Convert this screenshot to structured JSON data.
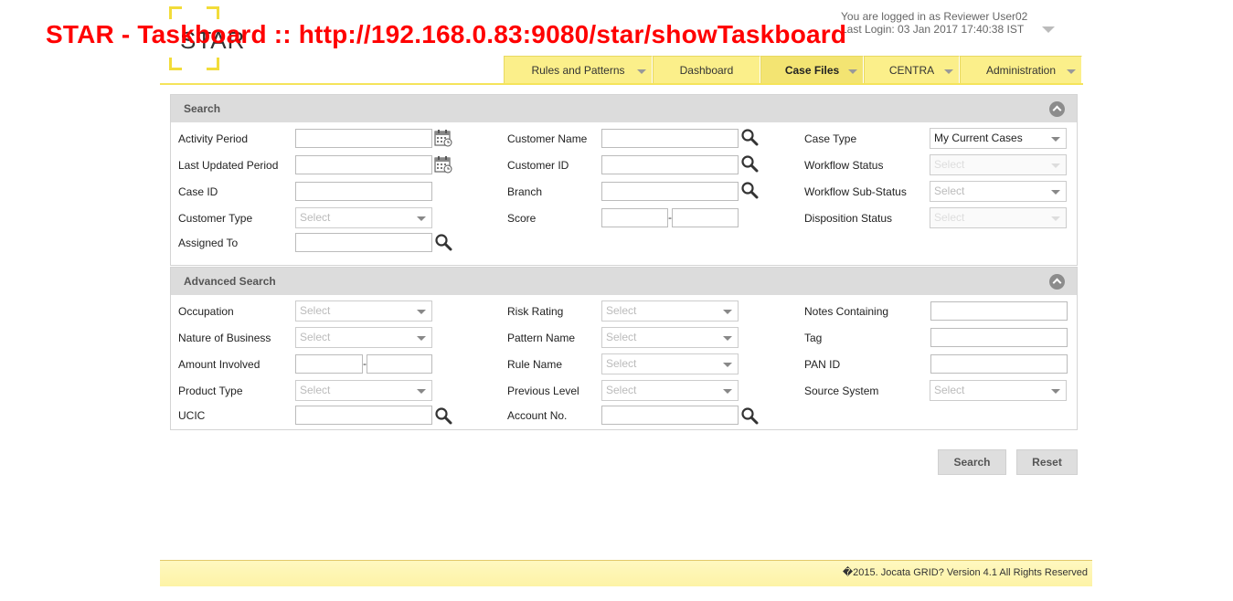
{
  "window_title": "STAR - Taskboard :: http://192.168.0.83:9080/star/showTaskboard",
  "logo": {
    "text": "STAR"
  },
  "user": {
    "logged_in": "You are logged in as Reviewer User02",
    "last_login": "Last Login: 03 Jan 2017 17:40:38 IST"
  },
  "nav": {
    "tabs": [
      {
        "label": "Rules and Patterns"
      },
      {
        "label": "Dashboard"
      },
      {
        "label": "Case Files"
      },
      {
        "label": "CENTRA"
      },
      {
        "label": "Administration"
      }
    ]
  },
  "search": {
    "title": "Search",
    "activity_period": "Activity Period",
    "last_updated_period": "Last Updated Period",
    "case_id": "Case ID",
    "customer_type": "Customer Type",
    "assigned_to": "Assigned To",
    "customer_name": "Customer Name",
    "customer_id": "Customer ID",
    "branch": "Branch",
    "score": "Score",
    "case_type": "Case Type",
    "workflow_status": "Workflow Status",
    "workflow_sub_status": "Workflow Sub-Status",
    "disposition_status": "Disposition Status",
    "case_type_value": "My Current Cases",
    "select_placeholder": "Select"
  },
  "advanced": {
    "title": "Advanced Search",
    "occupation": "Occupation",
    "nature_of_business": "Nature of Business",
    "amount_involved": "Amount Involved",
    "product_type": "Product Type",
    "ucic": "UCIC",
    "risk_rating": "Risk Rating",
    "pattern_name": "Pattern Name",
    "rule_name": "Rule Name",
    "previous_level": "Previous Level",
    "account_no": "Account No.",
    "notes_containing": "Notes Containing",
    "tag": "Tag",
    "pan_id": "PAN ID",
    "source_system": "Source System"
  },
  "actions": {
    "search": "Search",
    "reset": "Reset"
  },
  "footer": {
    "text": "�2015. Jocata GRID? Version 4.1 All Rights Reserved"
  },
  "colors": {
    "accent": "#fbef8a",
    "title_red": "#ff0000"
  }
}
